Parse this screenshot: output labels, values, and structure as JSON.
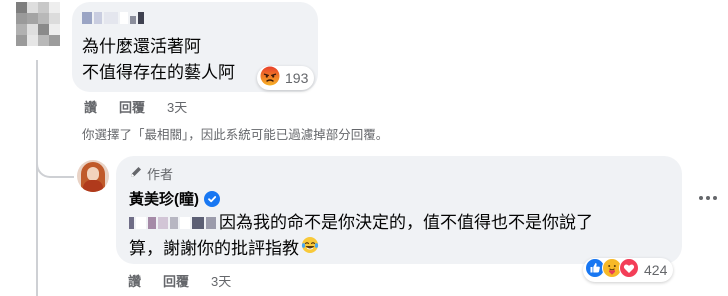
{
  "comment": {
    "line1": "為什麼還活著阿",
    "line2": "不值得存在的藝人阿",
    "reaction_count": "193",
    "reaction_icon": "angry-icon",
    "actions": {
      "like": "讚",
      "reply": "回覆",
      "time": "3天"
    }
  },
  "filter_notice": "你選擇了「最相關」，因此系統可能已過濾掉部分回覆。",
  "reply": {
    "author_badge": "作者",
    "author_name": "黃美珍(瞳)",
    "verified_icon": "verified-badge-icon",
    "line1": "因為我的命不是你決定的，值不值得也不是你說了",
    "line2": "算，謝謝你的批評指教",
    "emoji": "tears-of-joy-emoji",
    "reaction_count": "424",
    "reaction_icons": [
      "like-icon",
      "care-icon",
      "love-icon"
    ],
    "actions": {
      "like": "讚",
      "reply": "回覆",
      "time": "3天"
    }
  },
  "colors": {
    "bubble": "#f0f2f5",
    "secondary_text": "#65676b",
    "facebook_blue": "#1877f2",
    "thread_line": "#ced0d4"
  }
}
